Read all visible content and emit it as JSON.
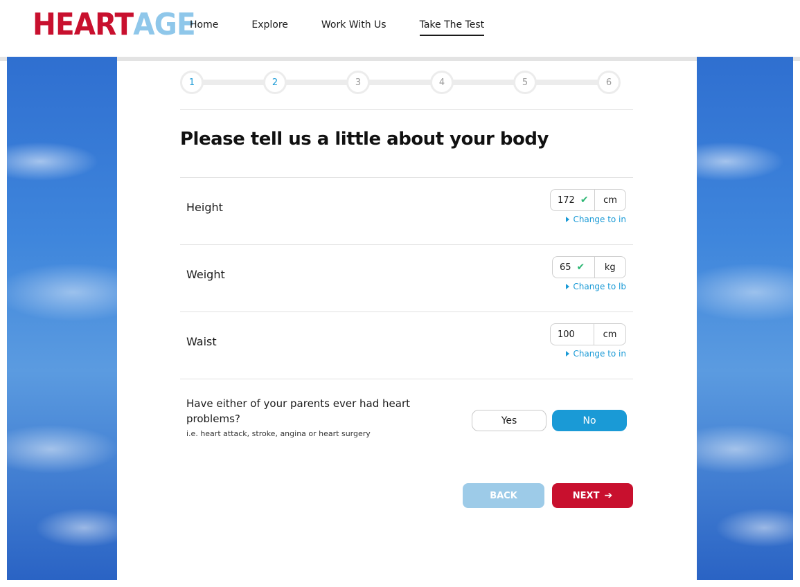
{
  "brand": {
    "logo_part1": "HEART",
    "logo_part2": "AGE",
    "colors": {
      "heart": "#c8102e",
      "age": "#8fc7ea",
      "accent": "#1a9ad6"
    }
  },
  "nav": {
    "items": [
      {
        "label": "Home"
      },
      {
        "label": "Explore"
      },
      {
        "label": "Work With Us"
      },
      {
        "label": "Take The Test",
        "active": true
      }
    ]
  },
  "steps": [
    "1",
    "2",
    "3",
    "4",
    "5",
    "6"
  ],
  "current_step": 2,
  "title": "Please tell us a little about your body",
  "fields": {
    "height": {
      "label": "Height",
      "value": "172",
      "unit": "cm",
      "validated": true,
      "change_link": "Change to in"
    },
    "weight": {
      "label": "Weight",
      "value": "65",
      "unit": "kg",
      "validated": true,
      "change_link": "Change to lb"
    },
    "waist": {
      "label": "Waist",
      "value": "100",
      "unit": "cm",
      "validated": false,
      "change_link": "Change to in"
    }
  },
  "parents_question": {
    "text": "Have either of your parents ever had heart problems?",
    "hint": "i.e. heart attack, stroke, angina or heart surgery",
    "options": {
      "yes": "Yes",
      "no": "No"
    },
    "selected": "No"
  },
  "buttons": {
    "back": "BACK",
    "next": "NEXT",
    "check_glyph": "✔",
    "arrow_glyph": "➔"
  }
}
